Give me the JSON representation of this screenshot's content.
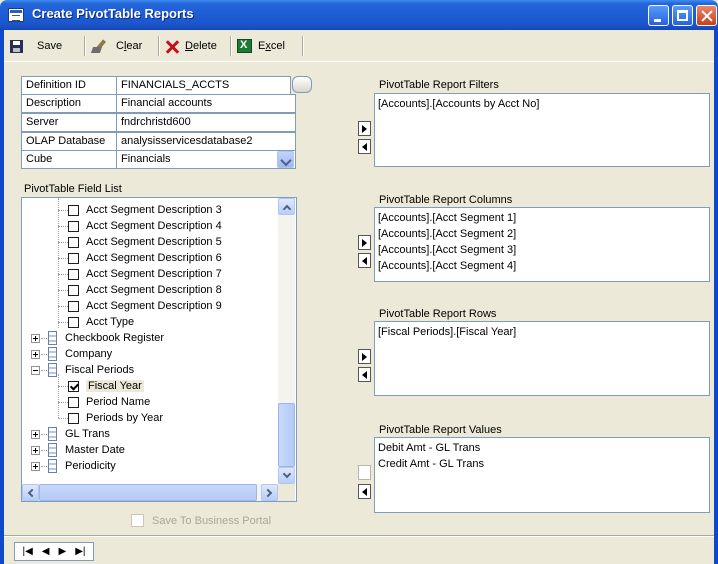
{
  "window": {
    "title": "Create PivotTable Reports"
  },
  "toolbar": {
    "save_label": "Save",
    "clear_label_pre": "C",
    "clear_label_u": "l",
    "clear_label_post": "ear",
    "delete_label_u": "D",
    "delete_label_post": "elete",
    "excel_label_pre": "E",
    "excel_label_u": "x",
    "excel_label_post": "cel"
  },
  "form": {
    "definition_id": {
      "label": "Definition ID",
      "value": "FINANCIALS_ACCTS"
    },
    "description": {
      "label": "Description",
      "value": "Financial accounts"
    },
    "server": {
      "label": "Server",
      "value": "fndrchristd600"
    },
    "olap_database": {
      "label": "OLAP Database",
      "value": "analysisservicesdatabase2"
    },
    "cube": {
      "label": "Cube",
      "value": "Financials"
    }
  },
  "field_list": {
    "label": "PivotTable Field List",
    "items": [
      {
        "text": "Acct Segment Description 3",
        "checked": false
      },
      {
        "text": "Acct Segment Description 4",
        "checked": false
      },
      {
        "text": "Acct Segment Description 5",
        "checked": false
      },
      {
        "text": "Acct Segment Description 6",
        "checked": false
      },
      {
        "text": "Acct Segment Description 7",
        "checked": false
      },
      {
        "text": "Acct Segment Description 8",
        "checked": false
      },
      {
        "text": "Acct Segment Description 9",
        "checked": false
      },
      {
        "text": "Acct Type",
        "checked": false
      },
      {
        "text": "Checkbook Register",
        "expander": "plus"
      },
      {
        "text": "Company",
        "expander": "plus"
      },
      {
        "text": "Fiscal Periods",
        "expander": "minus"
      },
      {
        "text": "Fiscal Year",
        "checked": true
      },
      {
        "text": "Period Name",
        "checked": false
      },
      {
        "text": "Periods by Year",
        "checked": false
      },
      {
        "text": "GL Trans",
        "expander": "plus"
      },
      {
        "text": "Master Date",
        "expander": "plus"
      },
      {
        "text": "Periodicity",
        "expander": "plus"
      }
    ],
    "scroll_position": 0.72
  },
  "save_to_portal": {
    "label": "Save To Business Portal",
    "checked": false,
    "enabled": false
  },
  "filters": {
    "label": "PivotTable Report Filters",
    "items": [
      "[Accounts].[Accounts by Acct No]"
    ]
  },
  "columns": {
    "label": "PivotTable Report Columns",
    "items": [
      "[Accounts].[Acct Segment 1]",
      "[Accounts].[Acct Segment 2]",
      "[Accounts].[Acct Segment 3]",
      "[Accounts].[Acct Segment 4]"
    ]
  },
  "rows": {
    "label": "PivotTable Report Rows",
    "items": [
      "[Fiscal Periods].[Fiscal Year]"
    ]
  },
  "values": {
    "label": "PivotTable Report Values",
    "items": [
      "Debit Amt - GL Trans",
      "Credit Amt - GL Trans"
    ]
  },
  "navigation": {
    "icons": [
      "first-record-icon",
      "previous-record-icon",
      "next-record-icon",
      "last-record-icon"
    ]
  }
}
